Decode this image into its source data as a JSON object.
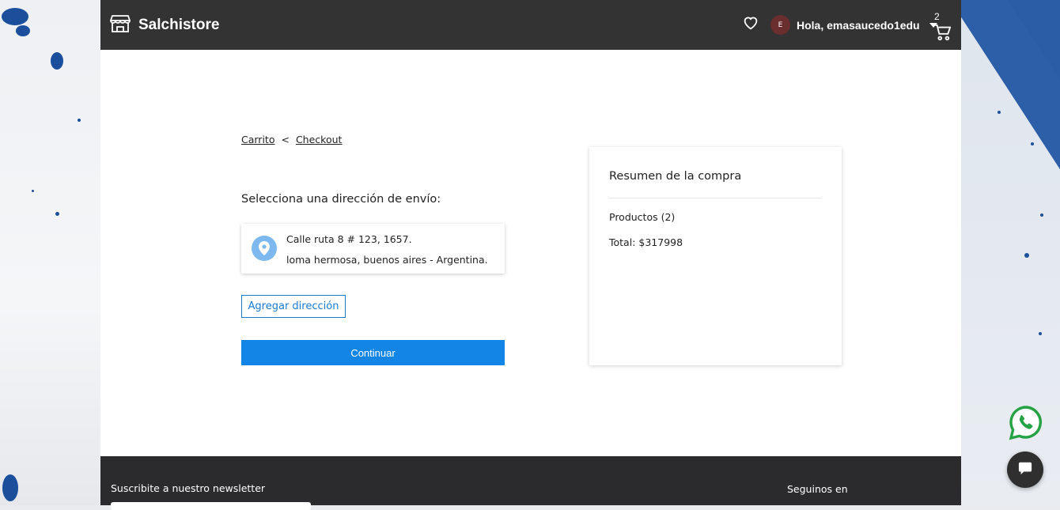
{
  "header": {
    "brand": "Salchistore",
    "greeting": "Hola, emasaucedo1edu",
    "avatar_initial": "E",
    "cart_count": "2"
  },
  "breadcrumb": {
    "cart": "Carrito",
    "separator": "<",
    "checkout": "Checkout"
  },
  "shipping": {
    "title": "Selecciona una dirección de envío:",
    "address_line1": "Calle ruta 8 # 123, 1657.",
    "address_line2": "loma hermosa, buenos aires - Argentina.",
    "add_address_label": "Agregar dirección",
    "continue_label": "Continuar"
  },
  "summary": {
    "title": "Resumen de la compra",
    "products": "Productos (2)",
    "total": "Total: $317998"
  },
  "footer": {
    "newsletter": "Suscribite a nuestro newsletter",
    "follow": "Seguinos en"
  },
  "colors": {
    "topbar": "#333333",
    "accent": "#1285e6",
    "pin": "#7db8ee",
    "whatsapp": "#25a244"
  },
  "icons": {
    "brand": "storefront-icon",
    "favorites": "heart-icon",
    "cart": "cart-icon",
    "address": "location-pin-icon",
    "whatsapp": "whatsapp-icon",
    "chat": "chat-icon"
  }
}
